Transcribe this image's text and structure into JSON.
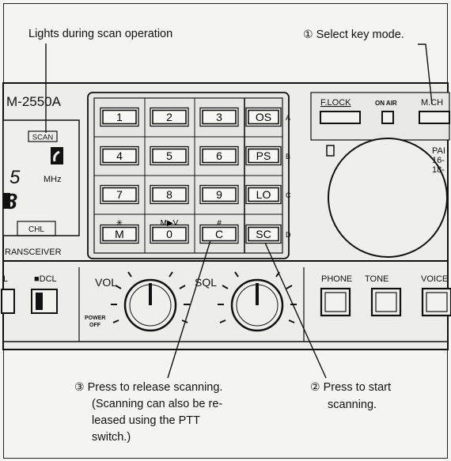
{
  "callouts": {
    "scan_light": "Lights during scan operation",
    "select_key": {
      "num": "①",
      "text": "Select key mode."
    },
    "start": {
      "num": "②",
      "line1": "Press to start",
      "line2": "scanning."
    },
    "release": {
      "num": "③",
      "line1": "Press to release scanning.",
      "line2": "(Scanning can also be re-",
      "line3": "leased using the PTT",
      "line4": "switch.)"
    }
  },
  "panel": {
    "model": "M-2550A",
    "scan_indicator": "SCAN",
    "freq_digit": "5",
    "freq_unit": "MHz",
    "channel_digit": "8",
    "chl_label": "CHL",
    "transceiver_label": "RANSCEIVER",
    "keypad": {
      "rows": [
        [
          "1",
          "2",
          "3",
          "OS"
        ],
        [
          "4",
          "5",
          "6",
          "PS"
        ],
        [
          "7",
          "8",
          "9",
          "LO"
        ],
        [
          "M",
          "0",
          "C",
          "SC"
        ]
      ],
      "row_letters": [
        "A",
        "B",
        "C",
        "D"
      ],
      "bottom_symbols": [
        "✳",
        "M▶V",
        "#"
      ]
    },
    "f_lock_label": "F.LOCK",
    "on_air_label": "ON AIR",
    "m_ch_label": "M.CH",
    "pair_lines": [
      "PAI",
      "16-",
      "18-"
    ],
    "vol_label": "VOL",
    "sql_label": "SQL",
    "power_off_label": "POWER\nOFF",
    "dcl_label": "■DCL",
    "left_label": "L",
    "bottom_buttons": [
      "PHONE",
      "TONE",
      "VOICE"
    ]
  }
}
